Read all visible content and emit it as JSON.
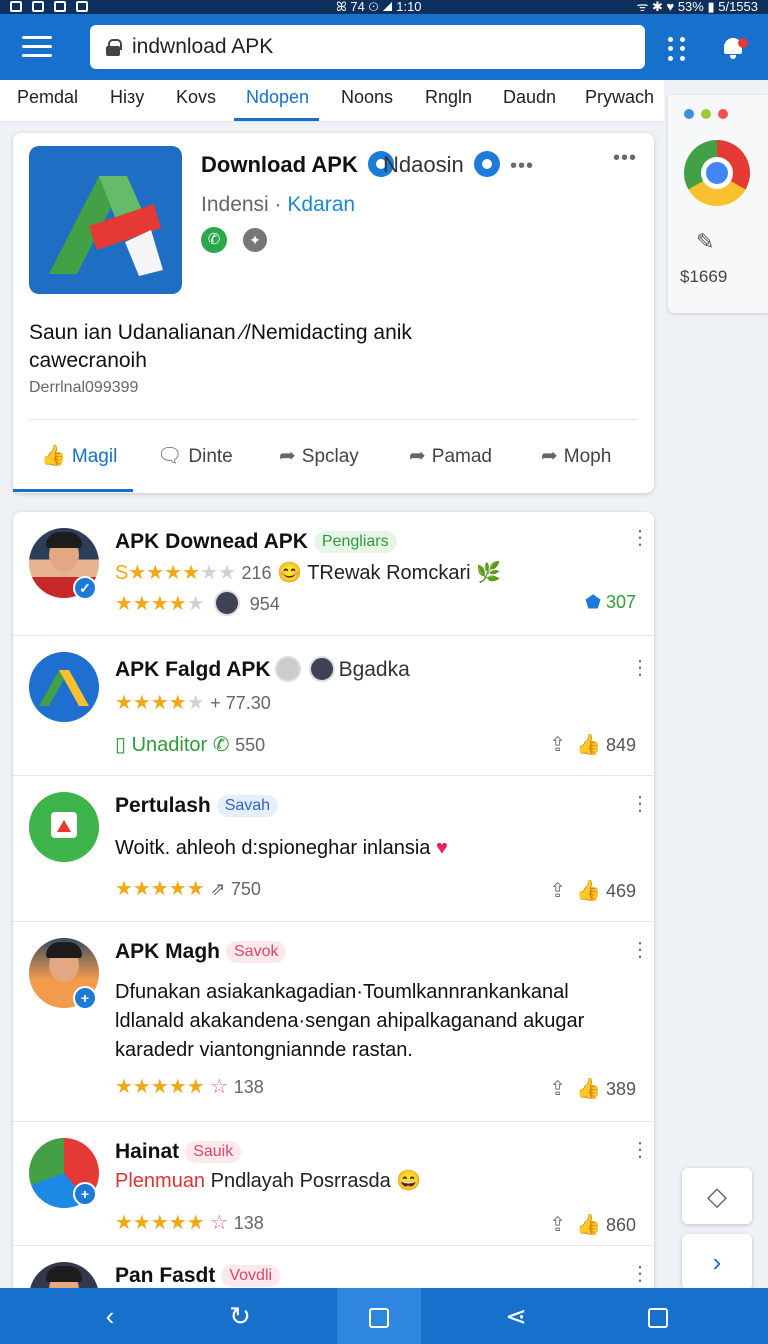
{
  "status_bar": {
    "center": "ꕤ 74 ⊙ ◢ 1:10",
    "right": "ᯤ ✱ ♥ 53% ▮ 5/1553"
  },
  "appbar": {
    "url_value": "indwnload APK"
  },
  "tabs": [
    {
      "label": "Pemdal"
    },
    {
      "label": "Hiзy"
    },
    {
      "label": "Kovs"
    },
    {
      "label": "Ndopen"
    },
    {
      "label": "Noons"
    },
    {
      "label": "Rngln"
    },
    {
      "label": "Daudn"
    },
    {
      "label": "Prуwach"
    }
  ],
  "active_tab": "Ndopen",
  "side_panel": {
    "price": "$1669"
  },
  "app": {
    "title": "Download APK",
    "subtitle": "Ndaosin",
    "developer_prefix": "Indensi · ",
    "developer_link": "Kdaran",
    "description": "Saun ian Udanalianan ⁄/Nemidacting anik cawecranoih",
    "id": "Derrlnal099399",
    "actions": [
      {
        "label": "Magil",
        "glyph": "👍"
      },
      {
        "label": "Dinte",
        "glyph": "🗨"
      },
      {
        "label": "Spclay",
        "glyph": "➦"
      },
      {
        "label": "Pamad",
        "glyph": "➦"
      },
      {
        "label": "Moph",
        "glyph": "➦"
      }
    ]
  },
  "reviews": [
    {
      "title": "APK Downead APK",
      "tag": "Pengliars",
      "line1_prefix": "S",
      "line1_count": "216",
      "line1_text": "TRewak Romckari",
      "line2_count": "954",
      "stat": "307"
    },
    {
      "title": "APK Falgd APK",
      "tag_text": "Bgadka",
      "line1_count": "+ 77.30",
      "line2_text": "Unaditor",
      "line2_count": "550",
      "stat": "849"
    },
    {
      "title": "Pertulash",
      "tag": "Savah",
      "body": "Woitk. ahleoh d:spioneghar inlansia",
      "count": "750",
      "stat": "469"
    },
    {
      "title": "APK Magh",
      "tag": "Savok",
      "body": "Dfunakan asiakankagadian·Toumlkannrankankanal ldlanald akakandena·sengan ahipalkaganand akugar karadedr viantongniannde rastan.",
      "count": "138",
      "stat": "389"
    },
    {
      "title": "Hainat",
      "tag": "Sauik",
      "body_red": "Plenmuan",
      "body_rest": " Pndlayah Posrrasda",
      "count": "138",
      "stat": "860"
    },
    {
      "title": "Pan Fasdt",
      "tag": "Vovdli"
    }
  ]
}
